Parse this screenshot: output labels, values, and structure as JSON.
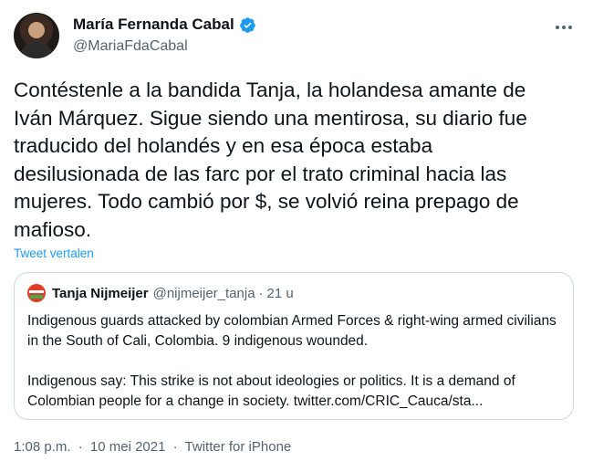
{
  "author": {
    "display_name": "María Fernanda Cabal",
    "handle": "@MariaFdaCabal",
    "verified_icon": "verified-badge-icon",
    "verified_color": "#1d9bf0"
  },
  "tweet": {
    "text": "Contéstenle a la bandida Tanja, la holandesa amante de\nIván Márquez. Sigue siendo una mentirosa, su diario fue\ntraducido  del holandés y en esa época estaba\ndesilusionada de las farc por el trato criminal hacia las\nmujeres. Todo cambió por $, se volvió reina prepago de\nmafioso.",
    "translate_label": "Tweet vertalen"
  },
  "quoted": {
    "name": "Tanja Nijmeijer",
    "handle": "@nijmeijer_tanja",
    "separator": "·",
    "time": "21 u",
    "paragraph1": "Indigenous guards attacked by colombian Armed Forces & right-wing armed civilians in the South of Cali, Colombia. 9 indigenous wounded.",
    "paragraph2": "Indigenous say: This strike is not about ideologies or politics. It is a demand of Colombian people for a change in society. twitter.com/CRIC_Cauca/sta..."
  },
  "meta": {
    "time": "1:08 p.m.",
    "sep1": "·",
    "date": "10 mei 2021",
    "sep2": "·",
    "source": "Twitter for iPhone"
  },
  "colors": {
    "text": "#0f1419",
    "secondary": "#536471",
    "link": "#1d9bf0",
    "border": "#cfd9de"
  }
}
